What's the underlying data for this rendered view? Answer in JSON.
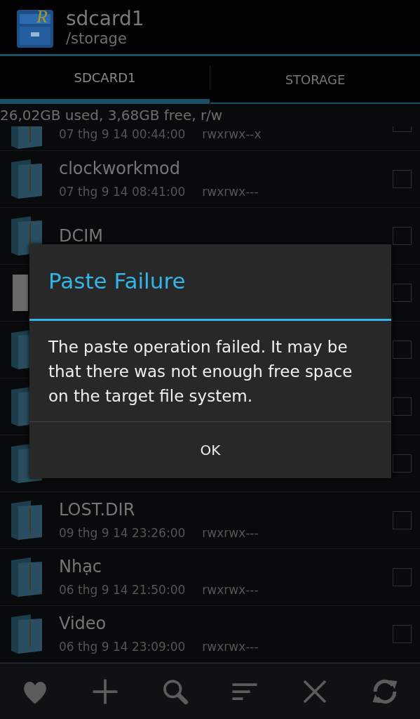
{
  "header": {
    "logo_letter": "R",
    "title": "sdcard1",
    "subtitle": "/storage"
  },
  "tabs": [
    {
      "label": "SDCARD1",
      "selected": true
    },
    {
      "label": "STORAGE",
      "selected": false
    }
  ],
  "storage_info": "26,02GB used, 3,68GB free, r/w",
  "files": [
    {
      "kind": "folder",
      "partial": true,
      "date": "07 thg 9 14 00:44:00",
      "perms": "rwxrwx--x",
      "checked": false
    },
    {
      "kind": "folder",
      "name": "clockworkmod",
      "date": "07 thg 9 14 08:41:00",
      "perms": "rwxrwx---",
      "checked": false
    },
    {
      "kind": "folder",
      "name": "DCIM",
      "checked": false
    },
    {
      "kind": "file",
      "checked": false
    },
    {
      "kind": "folder",
      "checked": false
    },
    {
      "kind": "folder",
      "checked": false
    },
    {
      "kind": "folder",
      "checked": false
    },
    {
      "kind": "folder",
      "name": "LOST.DIR",
      "date": "09 thg 9 14 23:26:00",
      "perms": "rwxrwx---",
      "checked": false
    },
    {
      "kind": "folder",
      "name": "Nhạc",
      "date": "06 thg 9 14 21:50:00",
      "perms": "rwxrwx---",
      "checked": false
    },
    {
      "kind": "folder",
      "name": "Video",
      "date": "06 thg 9 14 23:09:00",
      "perms": "rwxrwx---",
      "checked": false
    }
  ],
  "toolbar": [
    {
      "kind": "favorite"
    },
    {
      "kind": "add"
    },
    {
      "kind": "search"
    },
    {
      "kind": "sort"
    },
    {
      "kind": "close"
    },
    {
      "kind": "refresh"
    }
  ],
  "dialog": {
    "title": "Paste Failure",
    "message": "The paste operation failed. It may be that there was not enough free space on the target file system.",
    "buttons": [
      "OK"
    ]
  }
}
